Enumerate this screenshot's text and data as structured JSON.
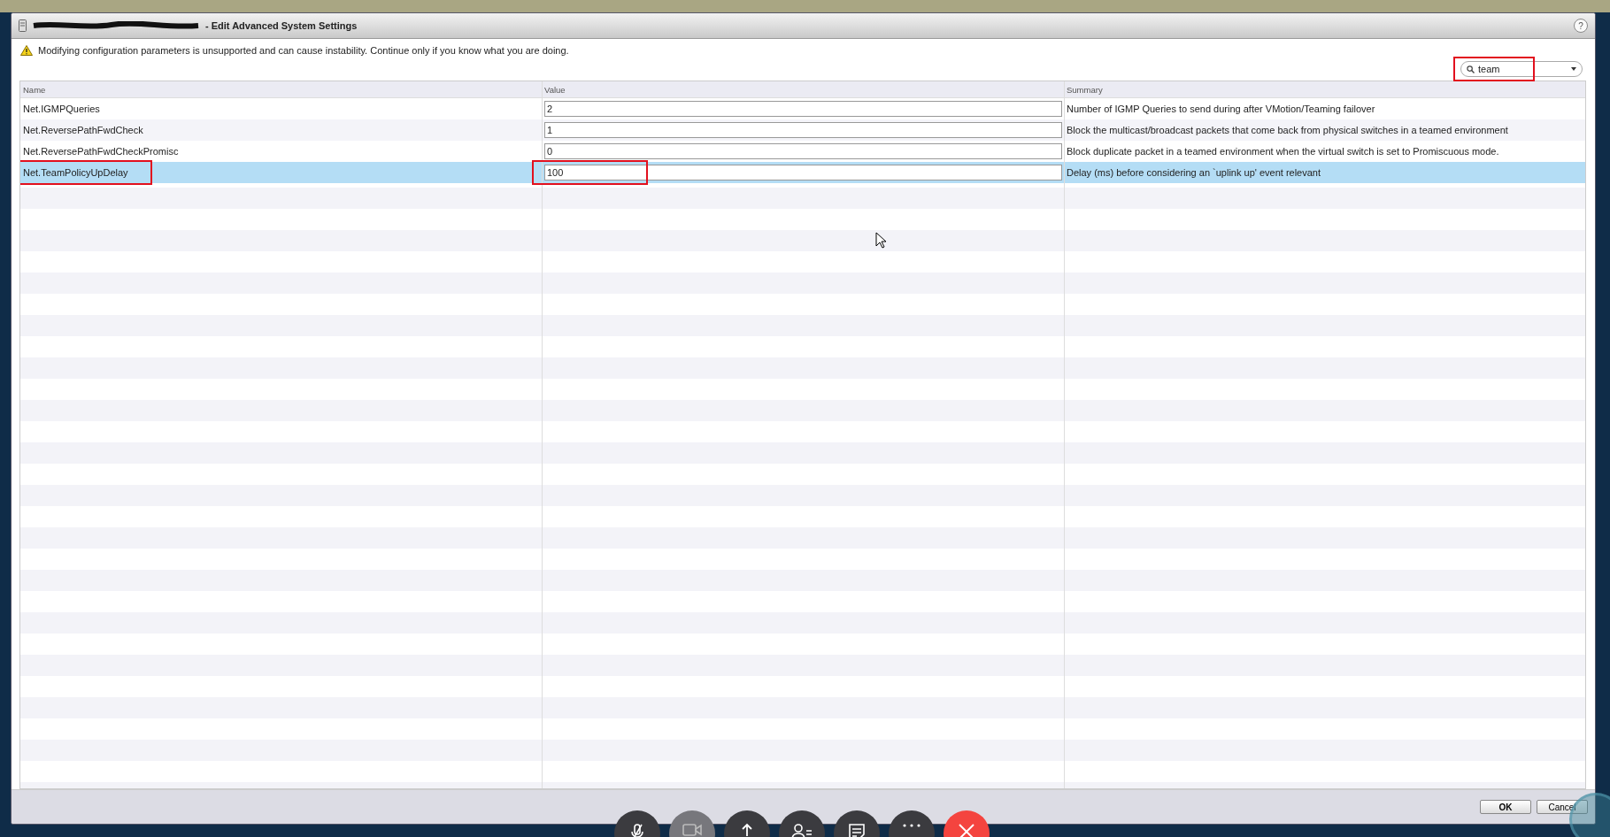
{
  "dialog": {
    "title": "- Edit Advanced System Settings",
    "title_redacted": true,
    "help": "?"
  },
  "warning": "Modifying configuration parameters is unsupported and can cause instability. Continue only if you know what you are doing.",
  "search": {
    "value": "team",
    "highlighted": true
  },
  "table": {
    "columns": [
      "Name",
      "Value",
      "Summary"
    ],
    "rows": [
      {
        "name": "Net.IGMPQueries",
        "value": "2",
        "summary": "Number of IGMP Queries to send during after VMotion/Teaming failover",
        "selected": false,
        "highlighted": false
      },
      {
        "name": "Net.ReversePathFwdCheck",
        "value": "1",
        "summary": "Block the multicast/broadcast packets that come back from physical switches in a teamed environment",
        "selected": false,
        "highlighted": false
      },
      {
        "name": "Net.ReversePathFwdCheckPromisc",
        "value": "0",
        "summary": "Block duplicate packet in a teamed environment when the virtual switch is set to Promiscuous mode.",
        "selected": false,
        "highlighted": false
      },
      {
        "name": "Net.TeamPolicyUpDelay",
        "value": "100",
        "summary": "Delay (ms) before considering an `uplink up' event relevant",
        "selected": true,
        "highlighted": true
      }
    ]
  },
  "buttons": [
    "OK",
    "Cancel"
  ],
  "call_bar": [
    {
      "kind": "mic-off",
      "disabled": false
    },
    {
      "kind": "video",
      "disabled": true
    },
    {
      "kind": "share",
      "disabled": false
    },
    {
      "kind": "participants",
      "disabled": false
    },
    {
      "kind": "notes",
      "disabled": false
    },
    {
      "kind": "more",
      "disabled": false
    },
    {
      "kind": "end",
      "disabled": false
    }
  ]
}
